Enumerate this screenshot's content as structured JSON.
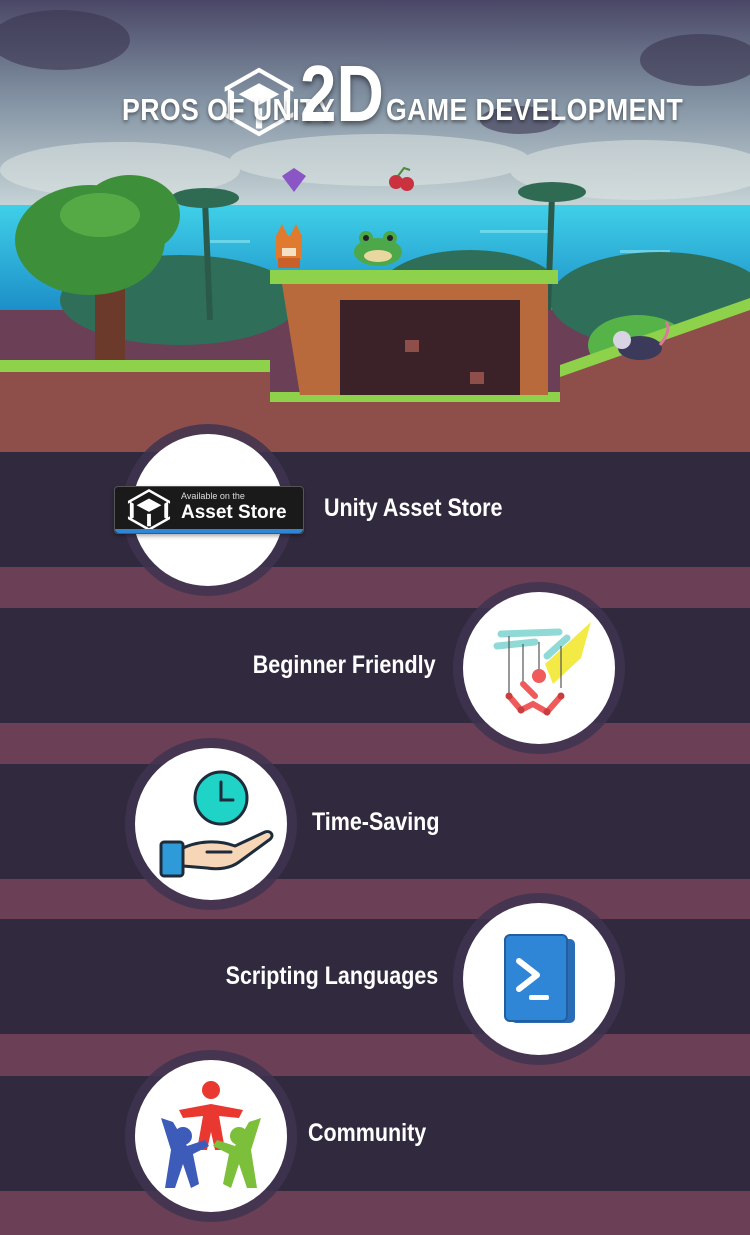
{
  "title": {
    "left": "PROS OF UNITY",
    "big": "2D",
    "right": "GAME DEVELOPMENT"
  },
  "badge": {
    "small": "Available on the",
    "big": "Asset Store"
  },
  "items": [
    {
      "label": "Unity Asset Store",
      "icon": "asset-store-badge-icon"
    },
    {
      "label": "Beginner Friendly",
      "icon": "marionette-icon"
    },
    {
      "label": "Time-Saving",
      "icon": "hand-with-clock-icon"
    },
    {
      "label": "Scripting Languages",
      "icon": "powershell-terminal-icon"
    },
    {
      "label": "Community",
      "icon": "people-group-icon"
    }
  ],
  "colors": {
    "dark_band": "#312a3f",
    "stripe": "#6b3f55",
    "sea": "#2fb8d8",
    "grass": "#8ed14a",
    "accent_teal": "#1cc8c0"
  }
}
